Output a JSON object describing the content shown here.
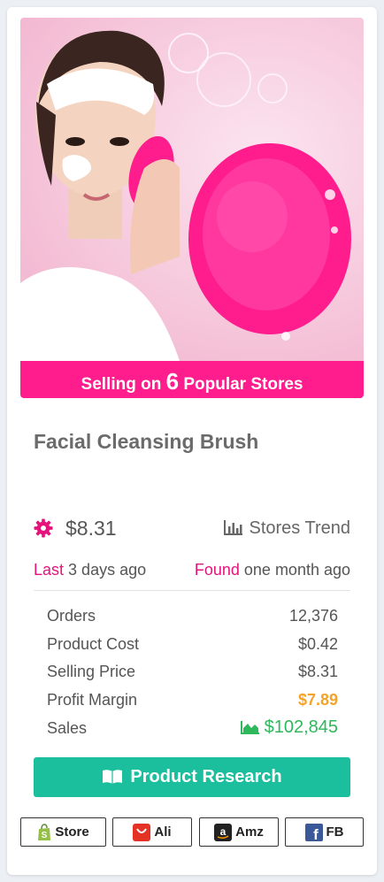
{
  "banner": {
    "prefix": "Selling on",
    "count": "6",
    "suffix": "Popular Stores"
  },
  "product": {
    "title": "Facial Cleansing Brush",
    "price": "$8.31",
    "trend_label": "Stores Trend",
    "last_label": "Last",
    "last_value": "3 days ago",
    "found_label": "Found",
    "found_value": "one month ago"
  },
  "stats": [
    {
      "label": "Orders",
      "value": "12,376"
    },
    {
      "label": "Product Cost",
      "value": "$0.42"
    },
    {
      "label": "Selling Price",
      "value": "$8.31"
    },
    {
      "label": "Profit Margin",
      "value": "$7.89"
    },
    {
      "label": "Sales",
      "value": "$102,845"
    }
  ],
  "research_button": "Product Research",
  "links": [
    {
      "label": "Store",
      "icon": "shopify-icon"
    },
    {
      "label": "Ali",
      "icon": "aliexpress-icon"
    },
    {
      "label": "Amz",
      "icon": "amazon-icon"
    },
    {
      "label": "FB",
      "icon": "facebook-icon"
    }
  ],
  "colors": {
    "banner": "#ff1c8d",
    "accent_pink": "#e6137c",
    "profit_orange": "#f4a32a",
    "sales_green": "#2db85b",
    "research_button": "#1bbf9e"
  }
}
